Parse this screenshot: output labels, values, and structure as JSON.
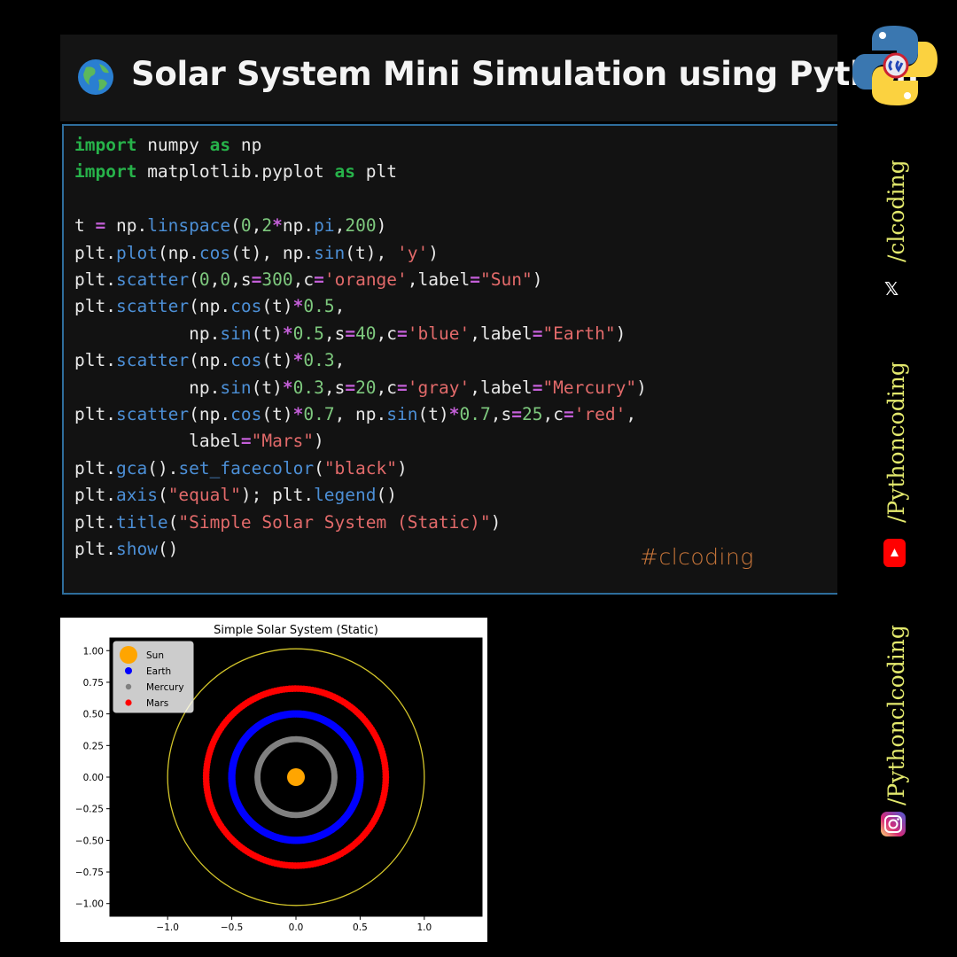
{
  "header": {
    "title": "Solar System Mini Simulation using Python"
  },
  "code": {
    "lines": [
      "import numpy as np",
      "import matplotlib.pyplot as plt",
      "",
      "t = np.linspace(0,2*np.pi,200)",
      "plt.plot(np.cos(t), np.sin(t), 'y')",
      "plt.scatter(0,0,s=300,c='orange',label=\"Sun\")",
      "plt.scatter(np.cos(t)*0.5,",
      "           np.sin(t)*0.5,s=40,c='blue',label=\"Earth\")",
      "plt.scatter(np.cos(t)*0.3,",
      "           np.sin(t)*0.3,s=20,c='gray',label=\"Mercury\")",
      "plt.scatter(np.cos(t)*0.7, np.sin(t)*0.7,s=25,c='red',",
      "           label=\"Mars\")",
      "plt.gca().set_facecolor(\"black\")",
      "plt.axis(\"equal\"); plt.legend()",
      "plt.title(\"Simple Solar System (Static)\")",
      "plt.show()"
    ],
    "hashtag": "#clcoding"
  },
  "sidebar": {
    "handle_x": "/clcoding",
    "handle_youtube": "/Pythoncoding",
    "handle_instagram": "/Pythonclcoding",
    "icons": [
      "python-logo",
      "x-icon",
      "youtube-icon",
      "instagram-icon"
    ],
    "handle_color": "#e3e96d"
  },
  "chart_data": {
    "type": "scatter",
    "title": "Simple Solar System (Static)",
    "xlabel": "",
    "ylabel": "",
    "xlim": [
      -1.45,
      1.45
    ],
    "ylim": [
      -1.1,
      1.1
    ],
    "xticks": [
      -1.0,
      -0.5,
      0.0,
      0.5,
      1.0
    ],
    "yticks": [
      -1.0,
      -0.75,
      -0.5,
      -0.25,
      0.0,
      0.25,
      0.5,
      0.75,
      1.0
    ],
    "xtick_labels": [
      "−1.0",
      "−0.5",
      "0.0",
      "0.5",
      "1.0"
    ],
    "ytick_labels": [
      "−1.00",
      "−0.75",
      "−0.50",
      "−0.25",
      "0.00",
      "0.25",
      "0.50",
      "0.75",
      "1.00"
    ],
    "background": "#000000",
    "legend_position": "upper left",
    "line": {
      "radius": 1.0,
      "color": "#d4c62a"
    },
    "series": [
      {
        "name": "Sun",
        "x": [
          0
        ],
        "y": [
          0
        ],
        "color": "#ffa500"
      },
      {
        "name": "Earth",
        "radius": 0.5,
        "points": 200,
        "color": "#0000ff"
      },
      {
        "name": "Mercury",
        "radius": 0.3,
        "points": 200,
        "color": "#808080"
      },
      {
        "name": "Mars",
        "radius": 0.7,
        "points": 200,
        "color": "#ff0000"
      }
    ]
  }
}
